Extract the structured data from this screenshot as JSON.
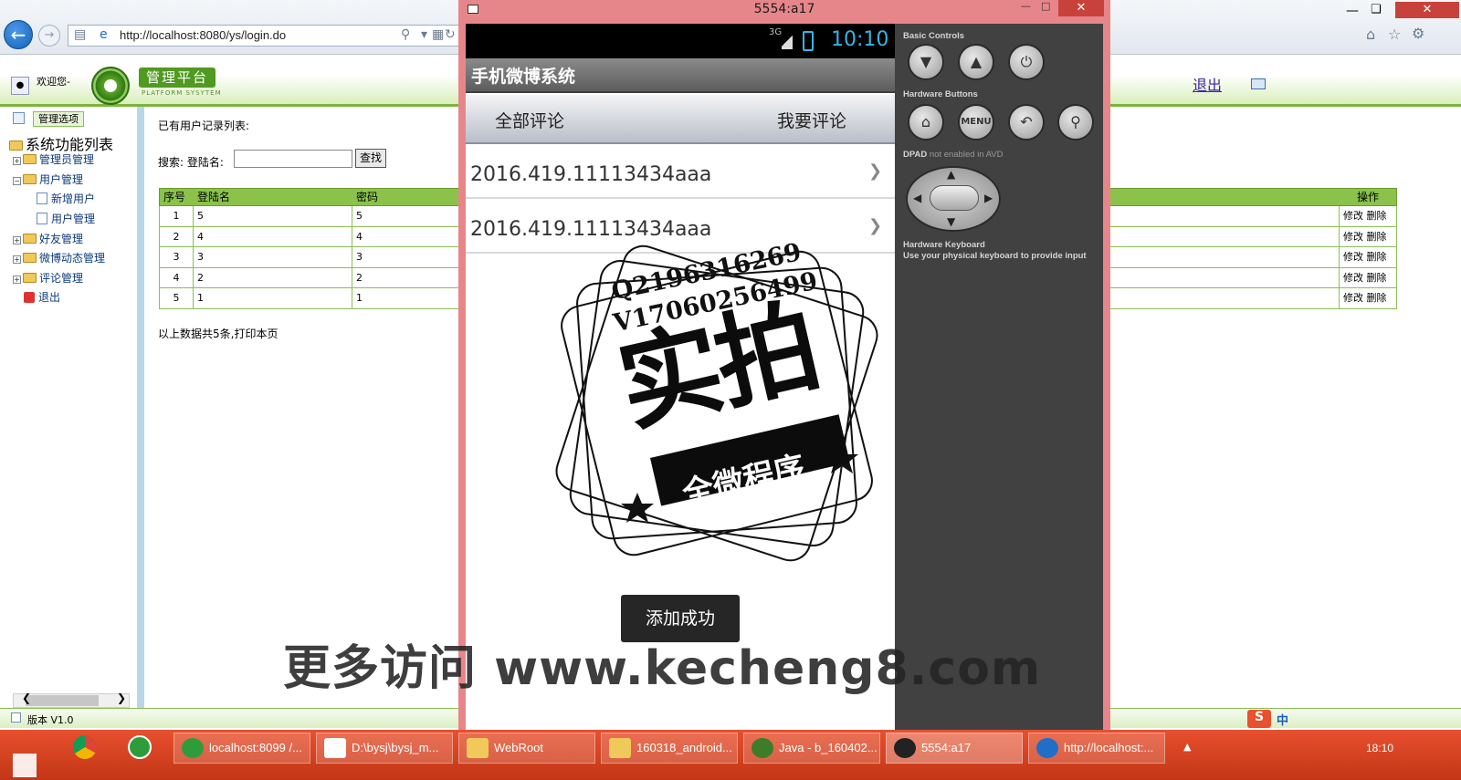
{
  "browser": {
    "url": "http://localhost:8080/ys/login.do"
  },
  "admin": {
    "welcome": "欢迎您-",
    "logo_title": "管理平台",
    "logo_subtitle": "PLATFORM SYSYTEM",
    "logout": "退出",
    "sidebar": {
      "header": "管理选项",
      "root": "系统功能列表",
      "items": [
        {
          "label": "管理员管理"
        },
        {
          "label": "用户管理"
        },
        {
          "label": "新增用户"
        },
        {
          "label": "用户管理"
        },
        {
          "label": "好友管理"
        },
        {
          "label": "微博动态管理"
        },
        {
          "label": "评论管理"
        },
        {
          "label": "退出"
        }
      ]
    },
    "list_title": "已有用户记录列表:",
    "search": {
      "label": "搜索:  登陆名:",
      "value": "",
      "button": "查找"
    },
    "table": {
      "headers": [
        "序号",
        "登陆名",
        "密码",
        "操作"
      ],
      "rows": [
        {
          "no": "1",
          "login": "5",
          "pwd": "5"
        },
        {
          "no": "2",
          "login": "4",
          "pwd": "4"
        },
        {
          "no": "3",
          "login": "3",
          "pwd": "3"
        },
        {
          "no": "4",
          "login": "2",
          "pwd": "2"
        },
        {
          "no": "5",
          "login": "1",
          "pwd": "1"
        }
      ],
      "edit": "修改",
      "delete": "删除"
    },
    "summary": "以上数据共5条,打印本页",
    "version": "版本 V1.0"
  },
  "emulator": {
    "window_title": "5554:a17",
    "status": {
      "network": "3G",
      "clock": "10:10"
    },
    "app_title": "手机微博系统",
    "tabs": [
      "全部评论",
      "我要评论"
    ],
    "list": [
      "2016.419.11113434aaa",
      "2016.419.11113434aaa"
    ],
    "toast": "添加成功",
    "controls": {
      "basic_label": "Basic Controls",
      "hardware_label": "Hardware Buttons",
      "menu_label": "MENU",
      "dpad_label": "DPAD",
      "dpad_note": "not enabled in AVD",
      "keyboard_label": "Hardware Keyboard",
      "keyboard_note": "Use your physical keyboard to provide input"
    }
  },
  "watermark": {
    "q": "Q2196316269",
    "v": "V17060256499",
    "big": "实拍",
    "ribbon": "全微程序",
    "url": "更多访问 www.kecheng8.com"
  },
  "taskbar": {
    "tasks": [
      "localhost:8099 /...",
      "D:\\bysj\\bysj_m...",
      "WebRoot",
      "160318_android...",
      "Java - b_160402...",
      "5554:a17",
      "http://localhost:..."
    ],
    "clock": "18:10",
    "ime": "中"
  },
  "colors": {
    "accent_green": "#8bc34a",
    "emu_frame": "#e7868a",
    "taskbar": "#c23616"
  }
}
